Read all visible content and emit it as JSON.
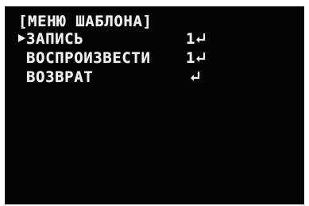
{
  "menu": {
    "title": "[МЕНЮ ШАБЛОНА]",
    "items": [
      {
        "label": "ЗАПИСЬ",
        "value": "1",
        "icon": "enter-icon",
        "selected": true
      },
      {
        "label": "ВОСПРОИЗВЕСТИ",
        "value": "1",
        "icon": "enter-icon",
        "selected": false
      },
      {
        "label": "ВОЗВРАТ",
        "value": "",
        "icon": "enter-icon",
        "selected": false
      }
    ]
  },
  "colors": {
    "background": "#050505",
    "text": "#f2f2f2"
  }
}
